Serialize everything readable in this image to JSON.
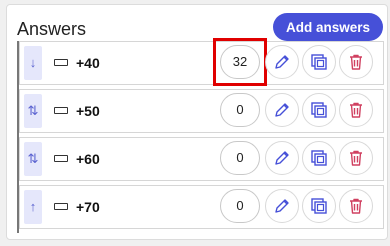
{
  "header": {
    "title": "Answers",
    "add_label": "Add answers"
  },
  "colors": {
    "accent": "#4650d8",
    "delete": "#d04060",
    "highlight": "#e00000"
  },
  "answers": [
    {
      "label": "+40",
      "count": "32",
      "handle": "↓",
      "handle_icon": "arrow-down-icon"
    },
    {
      "label": "+50",
      "count": "0",
      "handle": "⇅",
      "handle_icon": "arrow-updown-icon"
    },
    {
      "label": "+60",
      "count": "0",
      "handle": "⇅",
      "handle_icon": "arrow-updown-icon"
    },
    {
      "label": "+70",
      "count": "0",
      "handle": "↑",
      "handle_icon": "arrow-up-icon"
    }
  ],
  "icons": {
    "edit": "pencil-icon",
    "copy": "duplicate-icon",
    "delete": "trash-icon",
    "key": "keyboard-icon"
  }
}
